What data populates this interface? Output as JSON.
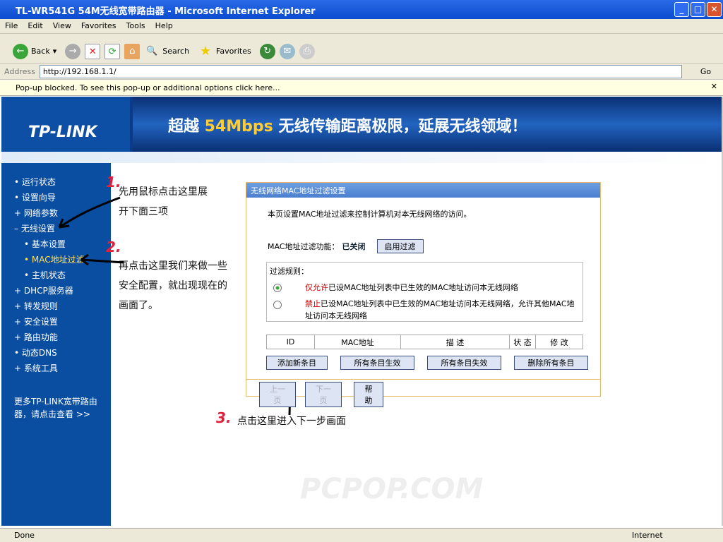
{
  "window": {
    "title": "TL-WR541G 54M无线宽带路由器 - Microsoft Internet Explorer"
  },
  "menu": [
    "File",
    "Edit",
    "View",
    "Favorites",
    "Tools",
    "Help"
  ],
  "toolbar": {
    "back": "Back",
    "search": "Search",
    "favorites": "Favorites"
  },
  "address": {
    "label": "Address",
    "url": "http://192.168.1.1/",
    "go": "Go"
  },
  "popup": {
    "text": "Pop-up blocked. To see this pop-up or additional options click here..."
  },
  "banner": {
    "logo": "TP-LINK",
    "slogan_pre": "超越 ",
    "slogan_hl": "54Mbps",
    "slogan_post": " 无线传输距离极限，延展无线领域！"
  },
  "sidebar": {
    "items": [
      "运行状态",
      "设置向导",
      "网络参数",
      "无线设置",
      "基本设置",
      "MAC地址过滤",
      "主机状态",
      "DHCP服务器",
      "转发规则",
      "安全设置",
      "路由功能",
      "动态DNS",
      "系统工具"
    ],
    "more": "更多TP-LINK宽带路由器，请点击查看 >>"
  },
  "annotations": {
    "n1": "1.",
    "t1a": "先用鼠标点击这里展",
    "t1b": "开下面三项",
    "n2": "2.",
    "t2a": "再点击这里我们来做一些",
    "t2b": "安全配置，就出现现在的",
    "t2c": "画面了。",
    "n3": "3.",
    "t3": "点击这里进入下一步画面"
  },
  "panel": {
    "title": "无线网络MAC地址过滤设置",
    "desc": "本页设置MAC地址过滤来控制计算机对本无线网络的访问。",
    "func_label": "MAC地址过滤功能：",
    "func_state": "已关闭",
    "enable_btn": "启用过滤",
    "rules_label": "过滤规则：",
    "rule1_hl": "仅允许",
    "rule1": "已设MAC地址列表中已生效的MAC地址访问本无线网络",
    "rule2_hl": "禁止",
    "rule2": "已设MAC地址列表中已生效的MAC地址访问本无线网络，允许其他MAC地址访问本无线网络",
    "columns": [
      "ID",
      "MAC地址",
      "描 述",
      "状 态",
      "修 改"
    ],
    "buttons": [
      "添加新条目",
      "所有条目生效",
      "所有条目失效",
      "删除所有条目"
    ],
    "prev": "上一页",
    "next": "下一页",
    "help": "帮 助"
  },
  "watermark": "PCPOP.COM",
  "status": {
    "left": "Done",
    "right": "Internet"
  }
}
